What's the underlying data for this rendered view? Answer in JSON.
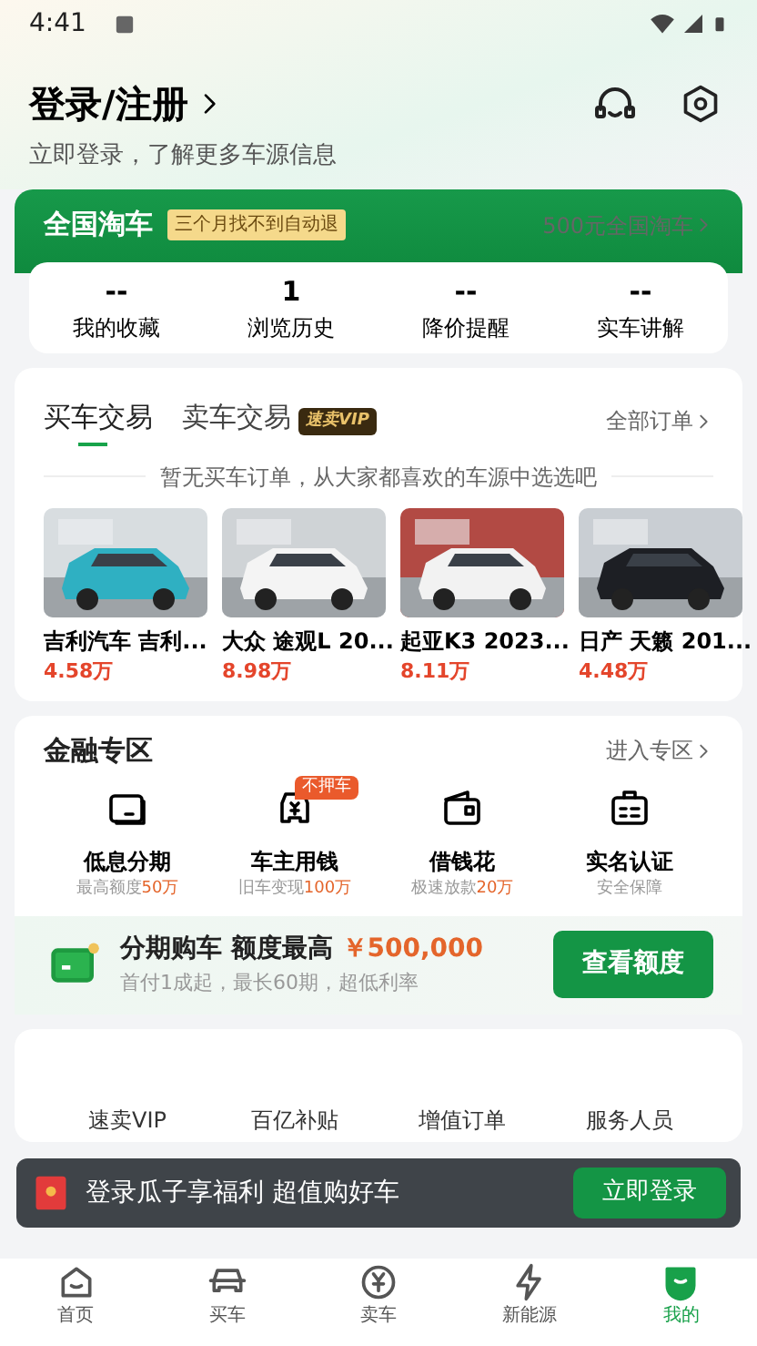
{
  "status_bar": {
    "time": "4:41"
  },
  "header": {
    "title": "登录/注册",
    "subtitle": "立即登录，了解更多车源信息"
  },
  "promo": {
    "title": "全国淘车",
    "tag": "三个月找不到自动退",
    "link": "500元全国淘车"
  },
  "stats": [
    {
      "value": "--",
      "label": "我的收藏"
    },
    {
      "value": "1",
      "label": "浏览历史"
    },
    {
      "value": "--",
      "label": "降价提醒"
    },
    {
      "value": "--",
      "label": "实车讲解"
    }
  ],
  "orders": {
    "tabs": [
      {
        "label": "买车交易",
        "selected": true
      },
      {
        "label": "卖车交易",
        "selected": false
      }
    ],
    "vip_badge": "速卖VIP",
    "link": "全部订单",
    "empty_message": "暂无买车订单，从大家都喜欢的车源中选选吧",
    "cars": [
      {
        "title": "吉利汽车 吉利...",
        "price": "4.58万"
      },
      {
        "title": "大众 途观L 20...",
        "price": "8.98万"
      },
      {
        "title": "起亚K3 2023...",
        "price": "8.11万"
      },
      {
        "title": "日产 天籁 201...",
        "price": "4.48万"
      }
    ]
  },
  "finance": {
    "title": "金融专区",
    "link": "进入专区",
    "items": [
      {
        "title": "低息分期",
        "desc": "最高额度",
        "highlight": "50万"
      },
      {
        "title": "车主用钱",
        "desc": "旧车变现",
        "highlight": "100万",
        "badge": "不押车"
      },
      {
        "title": "借钱花",
        "desc": "极速放款",
        "highlight": "20万"
      },
      {
        "title": "实名认证",
        "desc": "安全保障"
      }
    ]
  },
  "installment": {
    "title": "分期购车 额度最高",
    "amount": "￥500,000",
    "subtitle": "首付1成起，最长60期，超低利率",
    "button": "查看额度"
  },
  "services": [
    {
      "label": "速卖VIP"
    },
    {
      "label": "百亿补贴"
    },
    {
      "label": "增值订单"
    },
    {
      "label": "服务人员"
    }
  ],
  "login_banner": {
    "text": "登录瓜子享福利 超值购好车",
    "button": "立即登录"
  },
  "nav": [
    {
      "label": "首页",
      "selected": false
    },
    {
      "label": "买车",
      "selected": false
    },
    {
      "label": "卖车",
      "selected": false
    },
    {
      "label": "新能源",
      "selected": false
    },
    {
      "label": "我的",
      "selected": true
    }
  ]
}
